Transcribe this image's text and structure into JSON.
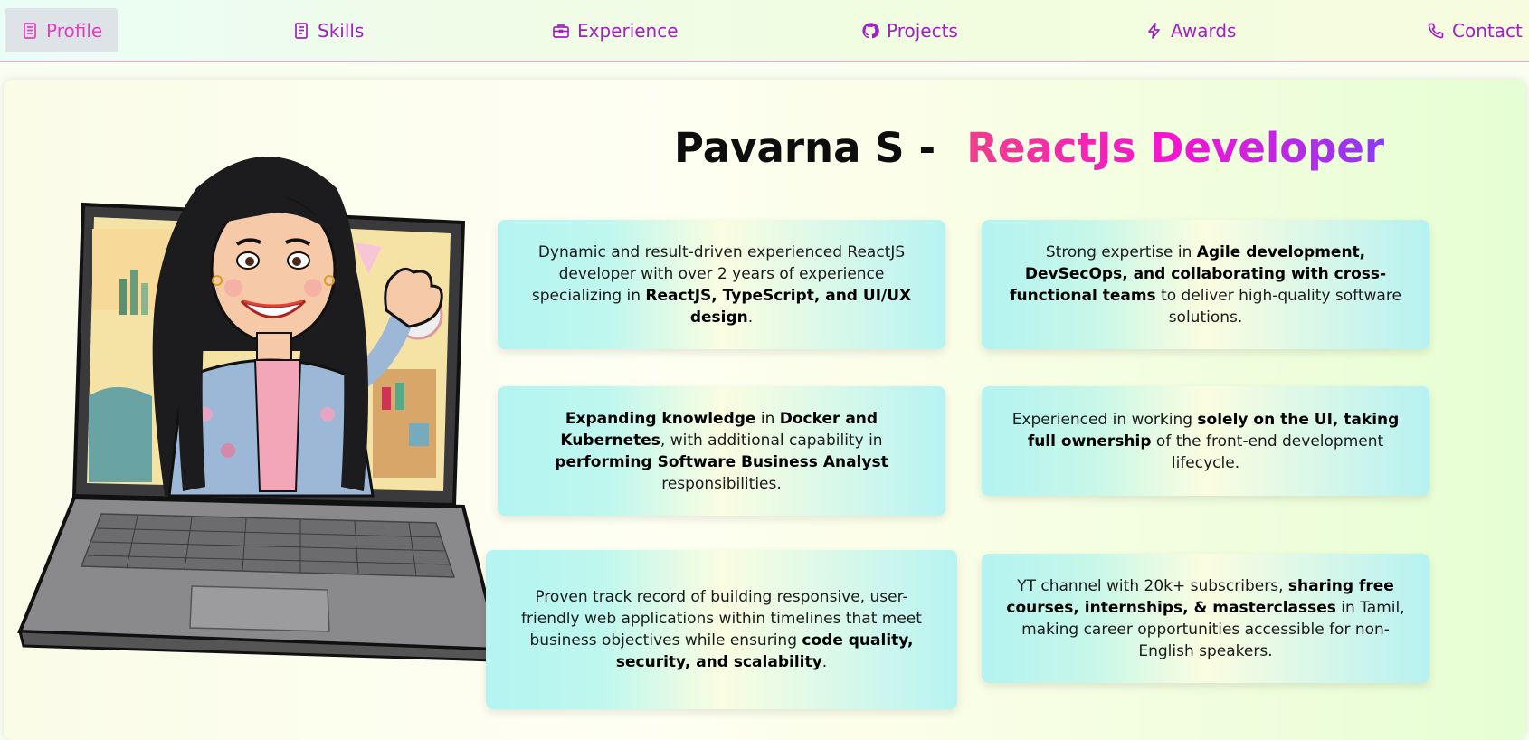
{
  "nav": {
    "items": [
      {
        "label": "Profile",
        "icon": "document-icon"
      },
      {
        "label": "Skills",
        "icon": "notebook-icon"
      },
      {
        "label": "Experience",
        "icon": "briefcase-icon"
      },
      {
        "label": "Projects",
        "icon": "github-icon"
      },
      {
        "label": "Awards",
        "icon": "lightning-icon"
      },
      {
        "label": "Contact",
        "icon": "phone-icon"
      }
    ],
    "active": "Profile"
  },
  "hero": {
    "name": "Pavarna S",
    "separator": "-",
    "role": "ReactJs Developer"
  },
  "cards": [
    {
      "parts": [
        {
          "t": "Dynamic and result-driven experienced ReactJS developer with over 2 years of experience specializing in ",
          "b": false
        },
        {
          "t": "ReactJS, TypeScript, and UI/UX design",
          "b": true
        },
        {
          "t": ".",
          "b": false
        }
      ]
    },
    {
      "parts": [
        {
          "t": "Strong expertise in ",
          "b": false
        },
        {
          "t": "Agile development, DevSecOps, and collaborating with cross-functional teams",
          "b": true
        },
        {
          "t": " to deliver high-quality software solutions.",
          "b": false
        }
      ]
    },
    {
      "parts": [
        {
          "t": "Expanding knowledge",
          "b": true
        },
        {
          "t": " in ",
          "b": false
        },
        {
          "t": "Docker and Kubernetes",
          "b": true
        },
        {
          "t": ", with additional capability in ",
          "b": false
        },
        {
          "t": "performing Software Business Analyst",
          "b": true
        },
        {
          "t": " responsibilities.",
          "b": false
        }
      ]
    },
    {
      "parts": [
        {
          "t": "Experienced in working ",
          "b": false
        },
        {
          "t": "solely on the UI, taking full ownership",
          "b": true
        },
        {
          "t": " of the front-end development lifecycle.",
          "b": false
        }
      ]
    },
    {
      "parts": [
        {
          "t": "Proven track record of building responsive, user-friendly web applications within timelines that meet business objectives while ensuring ",
          "b": false
        },
        {
          "t": "code quality, security, and scalability",
          "b": true
        },
        {
          "t": ".",
          "b": false
        }
      ]
    },
    {
      "parts": [
        {
          "t": "YT channel with 20k+ subscribers, ",
          "b": false
        },
        {
          "t": "sharing free courses, internships, & masterclasses",
          "b": true
        },
        {
          "t": " in Tamil, making career opportunities accessible for non-English speakers.",
          "b": false
        }
      ]
    }
  ],
  "colors": {
    "nav_text": "#a320c4",
    "nav_active_text": "#e23fc0",
    "nav_active_bg": "#dde3e6",
    "role_gradient": [
      "#ee3f8b",
      "#f414d2",
      "#8b3bf5"
    ]
  }
}
